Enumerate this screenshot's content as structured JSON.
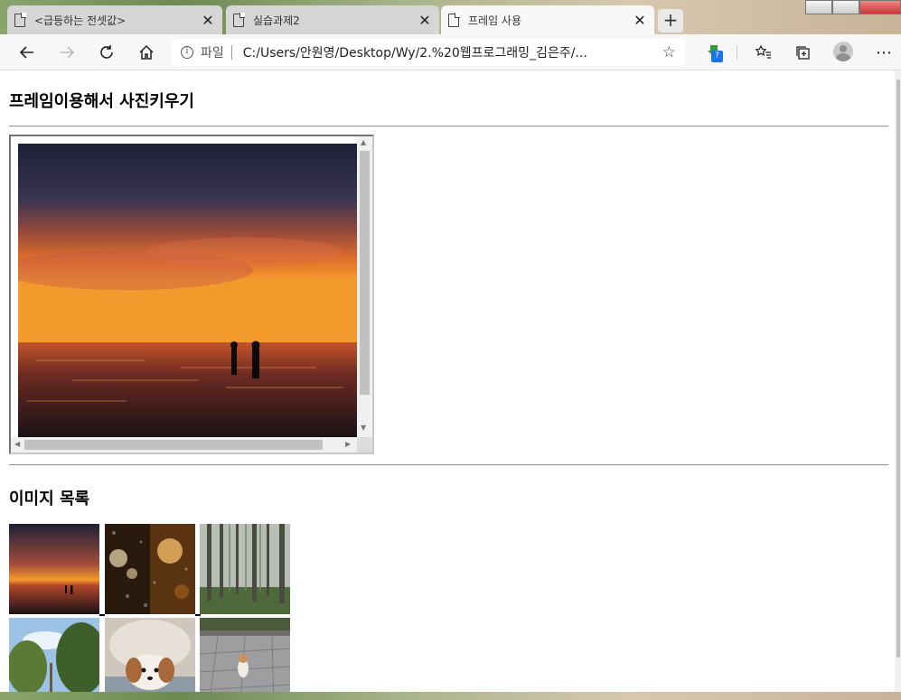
{
  "browser": {
    "tabs": [
      {
        "title": "<급등하는 전셋값>",
        "active": false
      },
      {
        "title": "실습과제2",
        "active": false
      },
      {
        "title": "프레임 사용",
        "active": true
      }
    ],
    "new_tab_label": "+",
    "address": {
      "scheme_label": "파일",
      "url": "C:/Users/안원영/Desktop/Wy/2.%20웹프로그래밍_김은주/..."
    },
    "extension_badge": "?"
  },
  "page": {
    "heading_frame": "프레임이용해서 사진키우기",
    "heading_list": "이미지 목록",
    "images": [
      {
        "name": "sunset-sea"
      },
      {
        "name": "rainy-window-bokeh"
      },
      {
        "name": "misty-forest"
      },
      {
        "name": "palm-trees-sky"
      },
      {
        "name": "puppy-blanket"
      },
      {
        "name": "puppy-on-pavement"
      }
    ]
  },
  "colors": {
    "tab_active": "#f7f7f7",
    "tab_inactive": "#d6d6d6",
    "rule": "#999999"
  }
}
